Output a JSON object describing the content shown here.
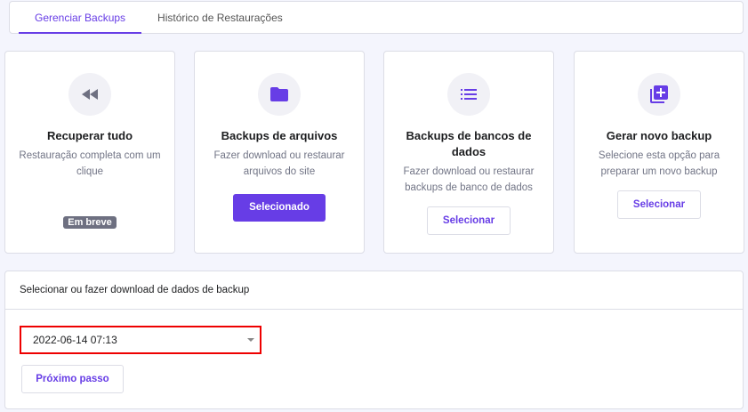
{
  "tabs": [
    {
      "label": "Gerenciar Backups"
    },
    {
      "label": "Histórico de Restaurações"
    }
  ],
  "cards": [
    {
      "title": "Recuperar tudo",
      "desc": "Restauração completa com um clique",
      "badge": "Em breve",
      "icon": "rewind-icon"
    },
    {
      "title": "Backups de arquivos",
      "desc": "Fazer download ou restaurar arquivos do site",
      "button": "Selecionado",
      "icon": "folder-icon"
    },
    {
      "title": "Backups de bancos de dados",
      "desc": "Fazer download ou restaurar backups de banco de dados",
      "button": "Selecionar",
      "icon": "list-icon"
    },
    {
      "title": "Gerar novo backup",
      "desc": "Selecione esta opção para preparar um novo backup",
      "button": "Selecionar",
      "icon": "add-library-icon"
    }
  ],
  "panel": {
    "title": "Selecionar ou fazer download de dados de backup",
    "selected": "2022-06-14 07:13",
    "next": "Próximo passo"
  },
  "colors": {
    "accent": "#673de6",
    "highlight": "#e00000"
  }
}
